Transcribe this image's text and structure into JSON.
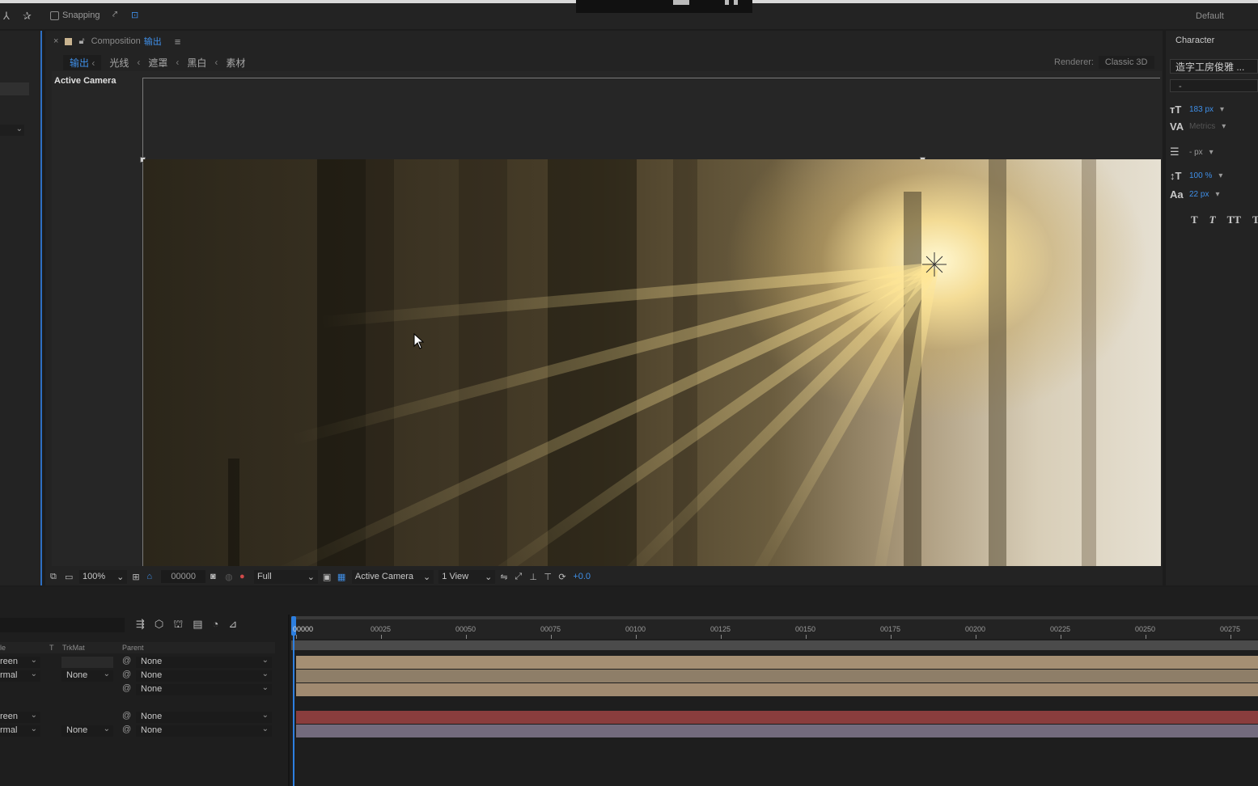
{
  "toolbar": {
    "snapping_label": "Snapping",
    "workspace": "Default"
  },
  "composition": {
    "tab_prefix": "Composition",
    "tab_name": "输出",
    "menu_icon": "hamburger-icon",
    "breadcrumbs": [
      "输出",
      "光线",
      "遮罩",
      "黑白",
      "素材"
    ],
    "renderer_label": "Renderer:",
    "renderer_value": "Classic 3D",
    "view_label": "Active Camera"
  },
  "viewer_bar": {
    "zoom": "100%",
    "timecode": "00000",
    "resolution": "Full",
    "camera": "Active Camera",
    "views": "1 View",
    "exposure": "+0.0"
  },
  "character": {
    "title": "Character",
    "font_family": "造字工房俊雅 ...",
    "font_style": "-",
    "font_size": "183 px",
    "kerning": "Metrics",
    "leading": "- px",
    "vertical_scale": "100 %",
    "baseline_shift": "22 px",
    "style_buttons": [
      "T",
      "T",
      "TT",
      "T"
    ]
  },
  "timeline": {
    "col_headers": {
      "mode": "le",
      "t": "T",
      "trkmat": "TrkMat",
      "parent": "Parent"
    },
    "ruler_ticks": [
      "00000",
      "00025",
      "00050",
      "00075",
      "00100",
      "00125",
      "00150",
      "00175",
      "00200",
      "00225",
      "00250",
      "00275"
    ],
    "layers": [
      {
        "mode": "reen",
        "trkmat": "",
        "parent": "None"
      },
      {
        "mode": "rmal",
        "trkmat": "None",
        "parent": "None"
      },
      {
        "mode": "",
        "trkmat": "",
        "parent": "None"
      },
      {
        "mode": "reen",
        "trkmat": "",
        "parent": "None"
      },
      {
        "mode": "rmal",
        "trkmat": "None",
        "parent": "None"
      }
    ],
    "bar_colors": [
      "#a58f73",
      "#8e7e68",
      "#a08a70",
      "#8a3d3d",
      "#736b7d"
    ]
  }
}
